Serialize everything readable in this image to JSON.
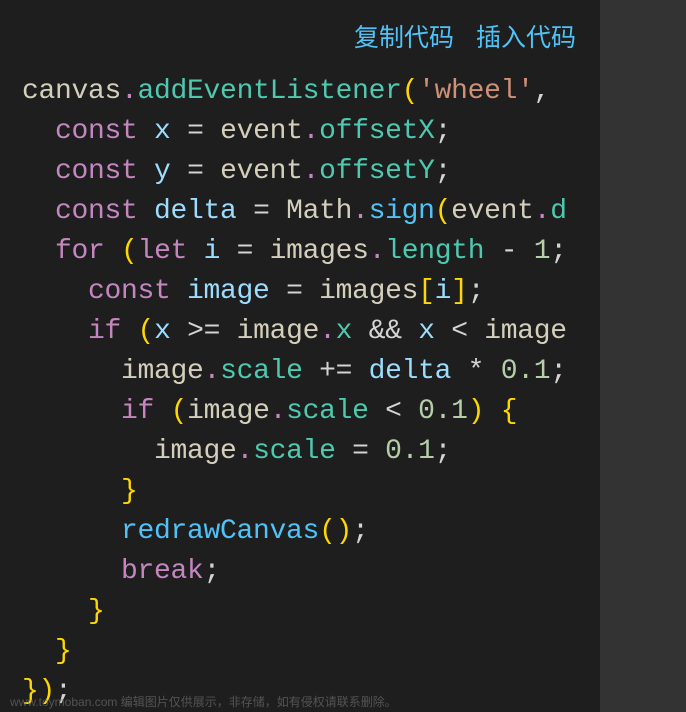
{
  "toolbar": {
    "copy_label": "复制代码",
    "insert_label": "插入代码"
  },
  "code": {
    "l1": {
      "canvas": "canvas",
      "addEl": "addEventListener",
      "wheel": "'wheel'"
    },
    "l2": {
      "const": "const",
      "x": "x",
      "event": "event",
      "offsetX": "offsetX"
    },
    "l3": {
      "const": "const",
      "y": "y",
      "event": "event",
      "offsetY": "offsetY"
    },
    "l4": {
      "const": "const",
      "delta": "delta",
      "Math": "Math",
      "sign": "sign",
      "event": "event",
      "d": "d"
    },
    "l5": {
      "for": "for",
      "let": "let",
      "i": "i",
      "images": "images",
      "length": "length",
      "one": "1"
    },
    "l6": {
      "const": "const",
      "image": "image",
      "images": "images",
      "i": "i"
    },
    "l7": {
      "if": "if",
      "x": "x",
      "image": "image",
      "x2": "x",
      "x3": "x",
      "image2": "image"
    },
    "l8": {
      "image": "image",
      "scale": "scale",
      "delta": "delta",
      "val": "0.1"
    },
    "l9": {
      "if": "if",
      "image": "image",
      "scale": "scale",
      "val": "0.1"
    },
    "l10": {
      "image": "image",
      "scale": "scale",
      "val": "0.1"
    },
    "l11": {},
    "l12": {
      "redraw": "redrawCanvas"
    },
    "l13": {
      "break": "break"
    },
    "l14": {},
    "l15": {},
    "l16": {}
  },
  "watermark": "www.toymoban.com 编辑图片仅供展示，非存储，如有侵权请联系删除。"
}
